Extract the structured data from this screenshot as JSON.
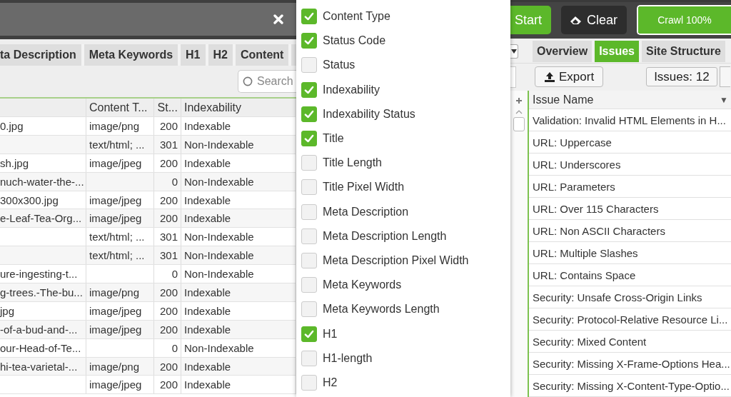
{
  "toolbar": {
    "buttons": [
      {
        "kind": "start",
        "label": "Start"
      },
      {
        "kind": "clear",
        "label": "Clear"
      }
    ],
    "progress": {
      "label": "Crawl 100%",
      "level": 1
    }
  },
  "left_tabs": [
    {
      "label": "ta Description",
      "selected": false
    },
    {
      "label": "Meta Keywords",
      "selected": false
    },
    {
      "label": "H1",
      "selected": false
    },
    {
      "label": "H2",
      "selected": false
    },
    {
      "label": "Content",
      "selected": false
    }
  ],
  "search": {
    "placeholder": "Search"
  },
  "url_table": {
    "columns": [
      "Content T...",
      "St...",
      "Indexability"
    ],
    "rows": [
      {
        "column_1": "0.jpg",
        "content_type": "image/png",
        "status_code": "200",
        "indexability": "Indexable"
      },
      {
        "content_type": "text/html; ...",
        "status_code": "301",
        "indexability": "Non-Indexable"
      },
      {
        "column_1": "sh.jpg",
        "content_type": "image/jpeg",
        "status_code": "200",
        "indexability": "Indexable"
      },
      {
        "column_1": "nuch-water-the-...",
        "status_code": "0",
        "indexability": "Non-Indexable"
      },
      {
        "column_1": "300x300.jpg",
        "content_type": "image/jpeg",
        "status_code": "200",
        "indexability": "Indexable"
      },
      {
        "column_1": "e-Leaf-Tea-Org...",
        "content_type": "image/jpeg",
        "status_code": "200",
        "indexability": "Indexable"
      },
      {
        "content_type": "text/html; ...",
        "status_code": "301",
        "indexability": "Non-Indexable"
      },
      {
        "content_type": "text/html; ...",
        "status_code": "301",
        "indexability": "Non-Indexable"
      },
      {
        "column_1": "ure-ingesting-t...",
        "status_code": "0",
        "indexability": "Non-Indexable"
      },
      {
        "column_1": "g-trees.-The-bu...",
        "content_type": "image/png",
        "status_code": "200",
        "indexability": "Indexable"
      },
      {
        "column_1": "jpg",
        "content_type": "image/jpeg",
        "status_code": "200",
        "indexability": "Indexable"
      },
      {
        "column_1": "-of-a-bud-and-...",
        "content_type": "image/jpeg",
        "status_code": "200",
        "indexability": "Indexable"
      },
      {
        "column_1": "our-Head-of-Te...",
        "status_code": "0",
        "indexability": "Non-Indexable"
      },
      {
        "column_1": "hi-tea-varietal-...",
        "content_type": "image/png",
        "status_code": "200",
        "indexability": "Indexable"
      },
      {
        "content_type": "image/jpeg",
        "status_code": "200",
        "indexability": "Indexable"
      }
    ]
  },
  "column_picker": [
    {
      "label": "Content Type",
      "checked": true
    },
    {
      "label": "Status Code",
      "checked": true
    },
    {
      "label": "Status",
      "checked": false
    },
    {
      "label": "Indexability",
      "checked": true
    },
    {
      "label": "Indexability Status",
      "checked": true
    },
    {
      "label": "Title",
      "checked": true
    },
    {
      "label": "Title Length",
      "checked": false
    },
    {
      "label": "Title Pixel Width",
      "checked": false
    },
    {
      "label": "Meta Description",
      "checked": false
    },
    {
      "label": "Meta Description Length",
      "checked": false
    },
    {
      "label": "Meta Description Pixel Width",
      "checked": false
    },
    {
      "label": "Meta Keywords",
      "checked": false
    },
    {
      "label": "Meta Keywords Length",
      "checked": false
    },
    {
      "label": "H1",
      "checked": true
    },
    {
      "label": "H1-length",
      "checked": false
    },
    {
      "label": "H2",
      "checked": false
    }
  ],
  "right_tabs": [
    {
      "label": "Overview",
      "selected": false
    },
    {
      "label": "Issues",
      "selected": true
    },
    {
      "label": "Site Structure",
      "selected": false
    }
  ],
  "export_button": "Export",
  "issues_count": "Issues: 12",
  "issues_table": {
    "column": "Issue Name",
    "sort_icon": "▼",
    "rows": [
      "Validation: Invalid HTML Elements in H...",
      "URL: Uppercase",
      "URL: Underscores",
      "URL: Parameters",
      "URL: Over 115 Characters",
      "URL: Non ASCII Characters",
      "URL: Multiple Slashes",
      "URL: Contains Space",
      "Security: Unsafe Cross-Origin Links",
      "Security: Protocol-Relative Resource Li...",
      "Security: Mixed Content",
      "Security: Missing X-Frame-Options Hea...",
      "Security: Missing X-Content-Type-Optio..."
    ]
  }
}
